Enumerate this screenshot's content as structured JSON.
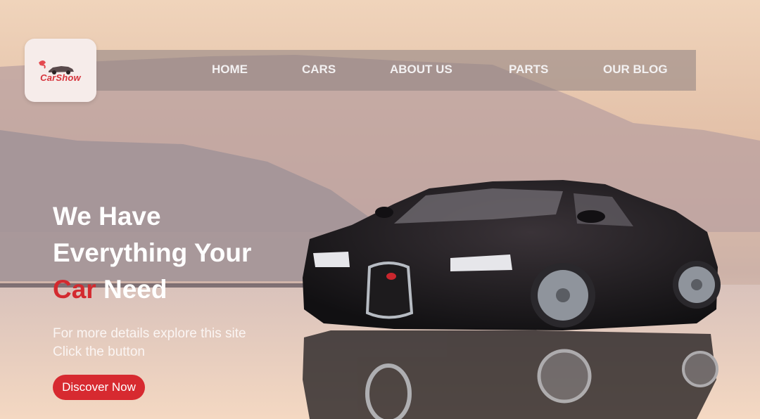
{
  "brand": {
    "logo_text": "CarShow",
    "accent_color": "#d32a2f"
  },
  "nav": {
    "items": [
      {
        "label": "HOME"
      },
      {
        "label": "CARS"
      },
      {
        "label": "ABOUT US"
      },
      {
        "label": "PARTS"
      },
      {
        "label": "OUR BLOG"
      }
    ]
  },
  "hero": {
    "headline_line1": "We Have",
    "headline_line2": "Everything Your",
    "headline_accent": "Car",
    "headline_rest": "Need",
    "subtext_line1": "For more details explore this site",
    "subtext_line2": "Click the button",
    "cta_label": "Discover Now"
  },
  "icons": {
    "logo": "car-logo-icon",
    "background": "sports-car-photo"
  }
}
